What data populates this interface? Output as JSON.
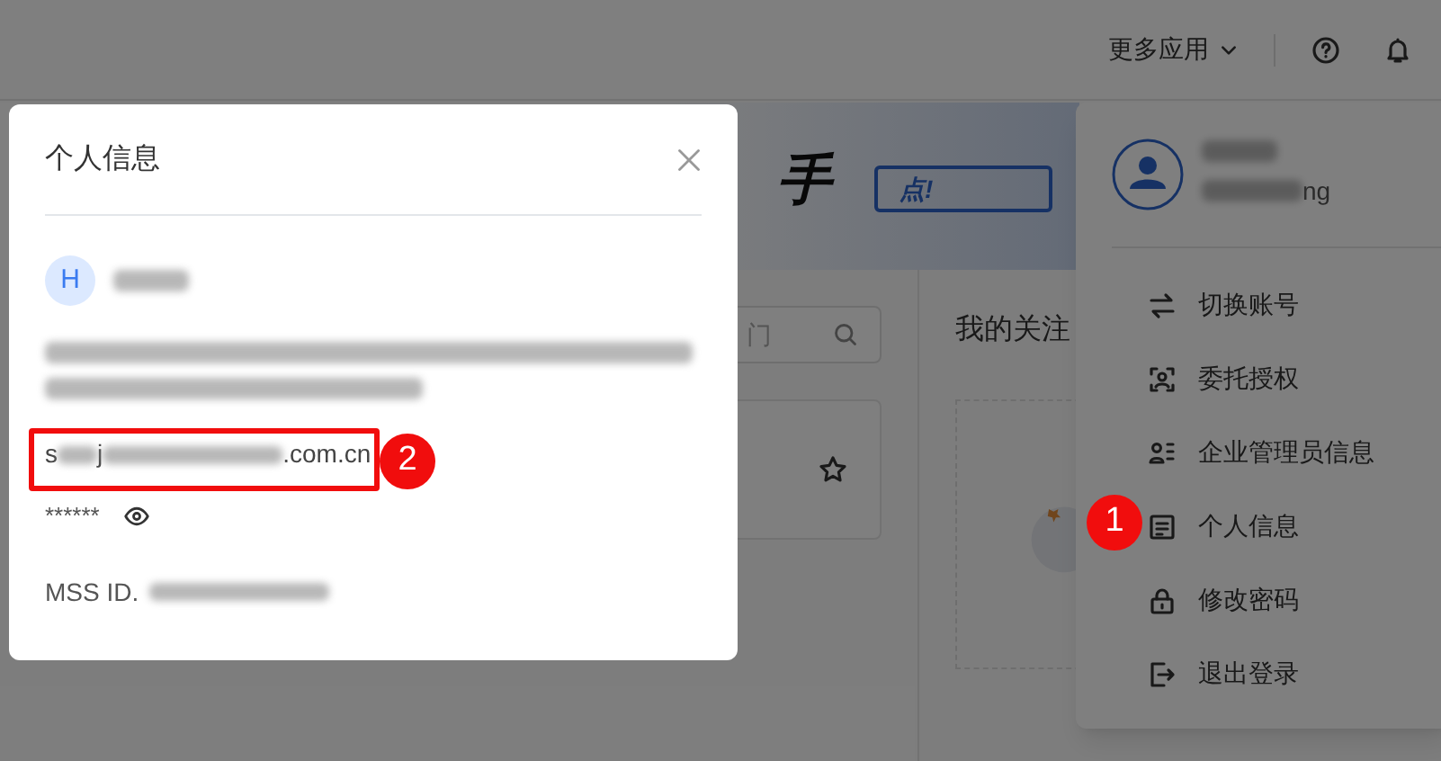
{
  "header": {
    "more_apps": "更多应用"
  },
  "banner": {
    "title_fragment": "手",
    "badge": "点!"
  },
  "search": {
    "placeholder_fragment": "门"
  },
  "follow_panel": {
    "title": "我的关注"
  },
  "user_menu": {
    "username_fragment": "ng",
    "items": [
      {
        "kind": "swap",
        "label": "切换账号"
      },
      {
        "kind": "delegate",
        "label": "委托授权"
      },
      {
        "kind": "admin",
        "label": "企业管理员信息"
      },
      {
        "kind": "profile",
        "label": "个人信息"
      },
      {
        "kind": "lock",
        "label": "修改密码"
      },
      {
        "kind": "logout",
        "label": "退出登录"
      }
    ]
  },
  "dialog": {
    "title": "个人信息",
    "avatar_letter": "H",
    "email_parts": [
      "s",
      "j",
      ".com.cn"
    ],
    "password": "******",
    "mss_label": "MSS ID."
  },
  "callouts": [
    {
      "number": "1"
    },
    {
      "number": "2"
    }
  ]
}
